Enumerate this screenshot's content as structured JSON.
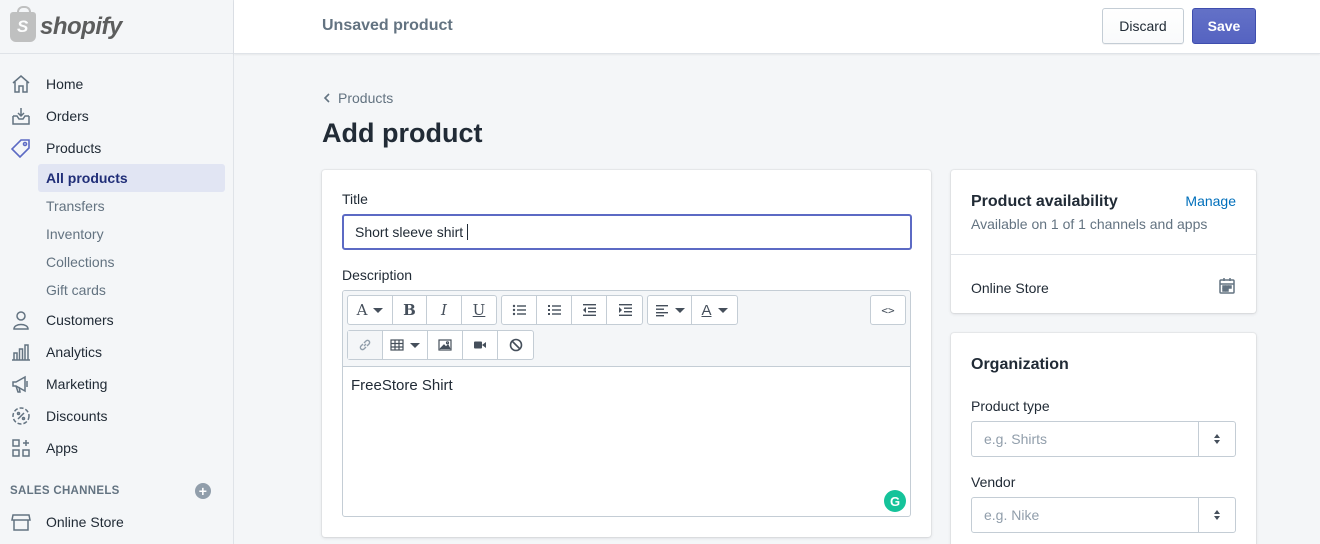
{
  "brand": {
    "logo_glyph": "S",
    "name": "shopify"
  },
  "sidebar": {
    "items": [
      {
        "label": "Home",
        "icon": "home-icon"
      },
      {
        "label": "Orders",
        "icon": "orders-icon"
      },
      {
        "label": "Products",
        "icon": "tag-icon"
      }
    ],
    "product_subitems": [
      "All products",
      "Transfers",
      "Inventory",
      "Collections",
      "Gift cards"
    ],
    "items_after": [
      {
        "label": "Customers",
        "icon": "person-icon"
      },
      {
        "label": "Analytics",
        "icon": "bar-chart-icon"
      },
      {
        "label": "Marketing",
        "icon": "megaphone-icon"
      },
      {
        "label": "Discounts",
        "icon": "discount-icon"
      },
      {
        "label": "Apps",
        "icon": "apps-icon"
      }
    ],
    "sales_channels_heading": "SALES CHANNELS",
    "add_glyph": "+",
    "channel_item": "Online Store"
  },
  "topbar": {
    "title": "Unsaved product",
    "discard_label": "Discard",
    "save_label": "Save"
  },
  "main": {
    "breadcrumb": "Products",
    "page_title": "Add product",
    "title_label": "Title",
    "title_value": "Short sleeve shirt",
    "description_label": "Description",
    "description_value": "FreeStore Shirt",
    "toolbar": {
      "font_glyph": "A",
      "bold_glyph": "B",
      "italic_glyph": "I",
      "underline_glyph": "U",
      "color_glyph": "A",
      "html_glyph": "<>"
    },
    "grammarly_glyph": "G"
  },
  "availability": {
    "title": "Product availability",
    "manage_label": "Manage",
    "subtitle": "Available on 1 of 1 channels and apps",
    "channel": "Online Store"
  },
  "organization": {
    "title": "Organization",
    "product_type_label": "Product type",
    "product_type_placeholder": "e.g. Shirts",
    "vendor_label": "Vendor",
    "vendor_placeholder": "e.g. Nike"
  },
  "colors": {
    "accent": "#5c6ac4",
    "link": "#006fbb",
    "selected_bg": "#e1e5f3",
    "selected_text": "#202e78"
  }
}
